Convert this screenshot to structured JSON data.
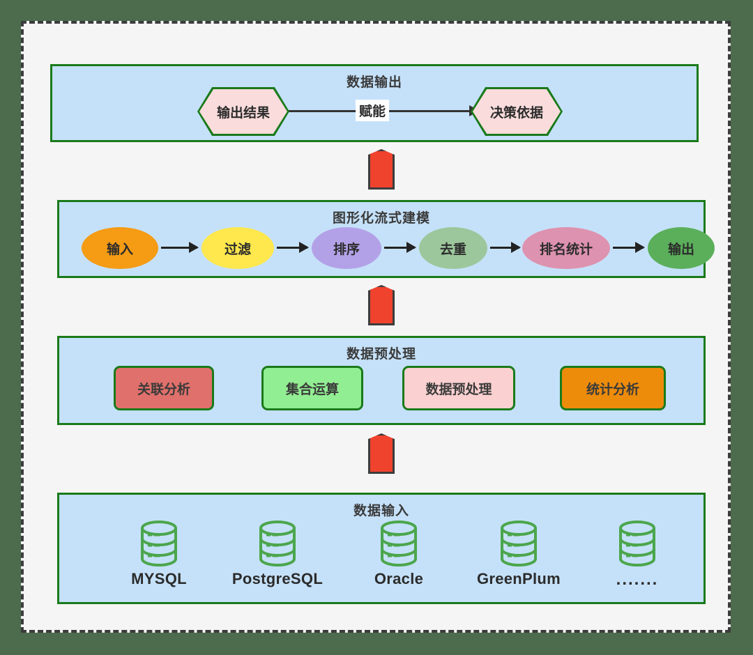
{
  "diagram": {
    "background_color": "#4d6b4d",
    "canvas_color": "#f5f5f5",
    "panel_color": "#c5e1f9",
    "panel_border_color": "#1a7a1a",
    "connector_color": "#f0432e"
  },
  "sections": {
    "output": {
      "title": "数据输出",
      "nodes": [
        {
          "label": "输出结果",
          "color": "#fadcdc",
          "border": "#1a7a1a",
          "shape": "hexagon"
        },
        {
          "label": "决策依据",
          "color": "#fadcdc",
          "border": "#1a7a1a",
          "shape": "hexagon"
        }
      ],
      "edge_label": "赋能"
    },
    "model": {
      "title": "图形化流式建模",
      "nodes": [
        {
          "label": "输入",
          "color": "#f59b14"
        },
        {
          "label": "过滤",
          "color": "#ffe84d"
        },
        {
          "label": "排序",
          "color": "#b3a1e8"
        },
        {
          "label": "去重",
          "color": "#9cc79c"
        },
        {
          "label": "排名统计",
          "color": "#dd92af"
        },
        {
          "label": "输出",
          "color": "#5baf5b"
        }
      ]
    },
    "preprocess": {
      "title": "数据预处理",
      "nodes": [
        {
          "label": "关联分析",
          "color": "#e0706b"
        },
        {
          "label": "集合运算",
          "color": "#92ee92"
        },
        {
          "label": "数据预处理",
          "color": "#fbd0d0"
        },
        {
          "label": "统计分析",
          "color": "#ed8b0b"
        }
      ]
    },
    "input": {
      "title": "数据输入",
      "icon_name": "database-cylinder-icon",
      "icon_color": "#4ca64c",
      "sources": [
        {
          "label": "MYSQL"
        },
        {
          "label": "PostgreSQL"
        },
        {
          "label": "Oracle"
        },
        {
          "label": "GreenPlum"
        },
        {
          "label": "......."
        }
      ]
    }
  },
  "connectors": [
    {
      "name": "input-to-preprocess",
      "direction": "up"
    },
    {
      "name": "preprocess-to-model",
      "direction": "up"
    },
    {
      "name": "model-to-output",
      "direction": "up"
    }
  ]
}
